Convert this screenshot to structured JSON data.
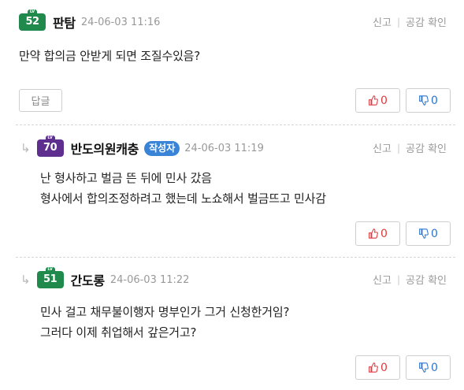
{
  "actions": {
    "report_label": "신고",
    "separator": "|",
    "like_check_label": "공감 확인"
  },
  "comments": [
    {
      "level": "52",
      "level_cap": "LV",
      "nickname": "판탐",
      "author_tag": "",
      "timestamp": "24-06-03 11:16",
      "lines": [
        "만약 합의금 안받게 되면 조질수있음?"
      ],
      "reply_label": "답글",
      "upvotes": "0",
      "downvotes": "0"
    },
    {
      "level": "70",
      "level_cap": "LV",
      "nickname": "반도의원캐충",
      "author_tag": "작성자",
      "timestamp": "24-06-03 11:19",
      "lines": [
        "난 형사하고 벌금 뜬 뒤에 민사 갔음",
        "형사에서 합의조정하려고 했는데 노쇼해서 벌금뜨고 민사감"
      ],
      "upvotes": "0",
      "downvotes": "0"
    },
    {
      "level": "51",
      "level_cap": "LV",
      "nickname": "간도롱",
      "author_tag": "",
      "timestamp": "24-06-03 11:22",
      "lines": [
        "민사 걸고 채무불이행자 명부인가 그거 신청한거임?",
        "그러다 이제 취업해서 갚은거고?"
      ],
      "upvotes": "0",
      "downvotes": "0"
    }
  ],
  "colors": {
    "level_green": "#1f8a4c",
    "level_purple": "#5e2f8f",
    "author_tag": "#3a84d8",
    "upvote": "#e0393e",
    "downvote": "#2b74d1"
  },
  "icons": {
    "reply": "reply-arrow-icon",
    "upvote": "thumbs-up-icon",
    "downvote": "thumbs-down-icon"
  }
}
